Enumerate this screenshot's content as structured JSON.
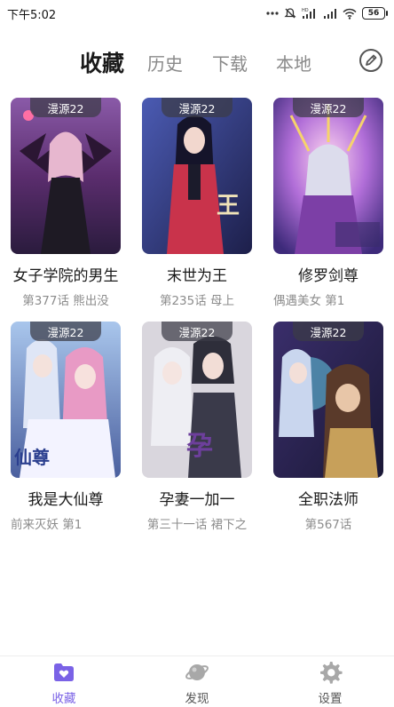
{
  "status_bar": {
    "time": "下午5:02",
    "battery": "56",
    "network_label": "HD"
  },
  "top_tabs": {
    "tabs": [
      {
        "label": "收藏",
        "active": true
      },
      {
        "label": "历史",
        "active": false
      },
      {
        "label": "下载",
        "active": false
      },
      {
        "label": "本地",
        "active": false
      }
    ],
    "edit_icon": "edit-pencil-icon"
  },
  "comics": [
    {
      "title": "女子学院的男生",
      "subtitle": "第377话 熊出没",
      "source": "漫源22",
      "cover_colors": [
        "#5b2d6e",
        "#d98ab6",
        "#2a1b3d"
      ]
    },
    {
      "title": "末世为王",
      "subtitle": "第235话 母上",
      "source": "漫源22",
      "cover_colors": [
        "#3a3f8f",
        "#c9334b",
        "#f0e3b8"
      ]
    },
    {
      "title": "修罗剑尊",
      "subtitle": "偶遇美女      第1",
      "source": "漫源22",
      "cover_colors": [
        "#6a4fb3",
        "#e57ab6",
        "#f6d36b"
      ]
    },
    {
      "title": "我是大仙尊",
      "subtitle": "前来灭妖      第1",
      "source": "漫源22",
      "cover_colors": [
        "#7ea6d8",
        "#e89ac5",
        "#f3f3ff"
      ]
    },
    {
      "title": "孕妻一加一",
      "subtitle": "第三十一话 裙下之",
      "source": "漫源22",
      "cover_colors": [
        "#c9c6cf",
        "#3a3a4a",
        "#6d3f9c"
      ]
    },
    {
      "title": "全职法师",
      "subtitle": "第567话",
      "source": "漫源22",
      "cover_colors": [
        "#3a2e6b",
        "#66d0e8",
        "#c7a05a"
      ]
    }
  ],
  "bottom_nav": {
    "items": [
      {
        "label": "收藏",
        "icon": "heart-folder-icon",
        "active": true
      },
      {
        "label": "发现",
        "icon": "planet-icon",
        "active": false
      },
      {
        "label": "设置",
        "icon": "gear-icon",
        "active": false
      }
    ]
  },
  "colors": {
    "accent": "#7a62e6",
    "tag_bg": "#3c3c46",
    "muted_text": "#8c8c8c"
  }
}
